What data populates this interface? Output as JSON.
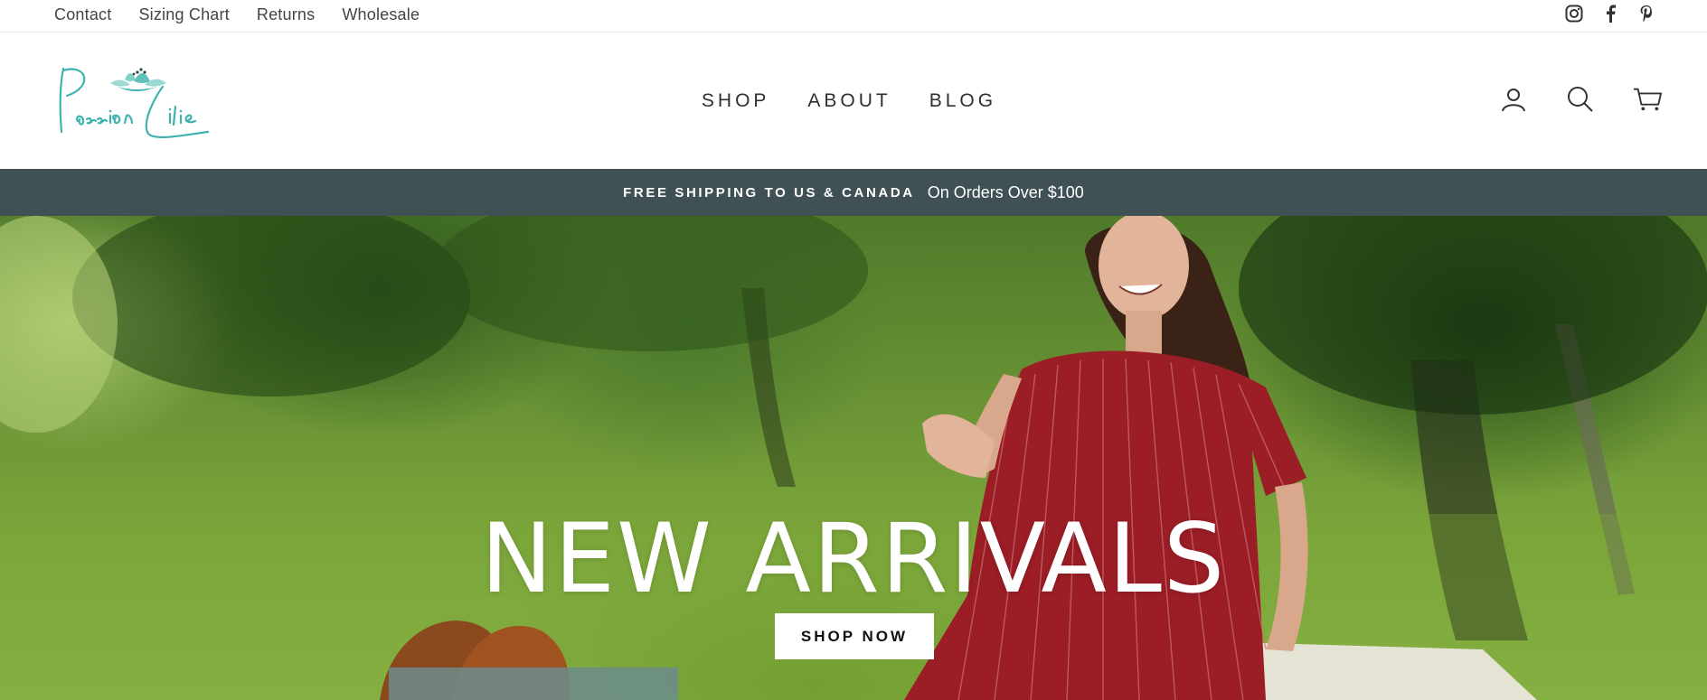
{
  "utility_bar": {
    "links": [
      "Contact",
      "Sizing Chart",
      "Returns",
      "Wholesale"
    ],
    "social_icons": [
      "instagram-icon",
      "facebook-icon",
      "pinterest-icon"
    ]
  },
  "header": {
    "logo_text": "Passion Lilie",
    "nav": [
      "SHOP",
      "ABOUT",
      "BLOG"
    ],
    "icons": [
      "account-icon",
      "search-icon",
      "cart-icon"
    ]
  },
  "announcement": {
    "strong": "FREE SHIPPING TO US & CANADA",
    "light": "On Orders Over $100",
    "bg_color": "#3f5155"
  },
  "hero": {
    "title": "NEW ARRIVALS",
    "button_label": "SHOP NOW"
  },
  "colors": {
    "logo_teal": "#3fb3b0",
    "text_dark": "#2f2f2f"
  }
}
